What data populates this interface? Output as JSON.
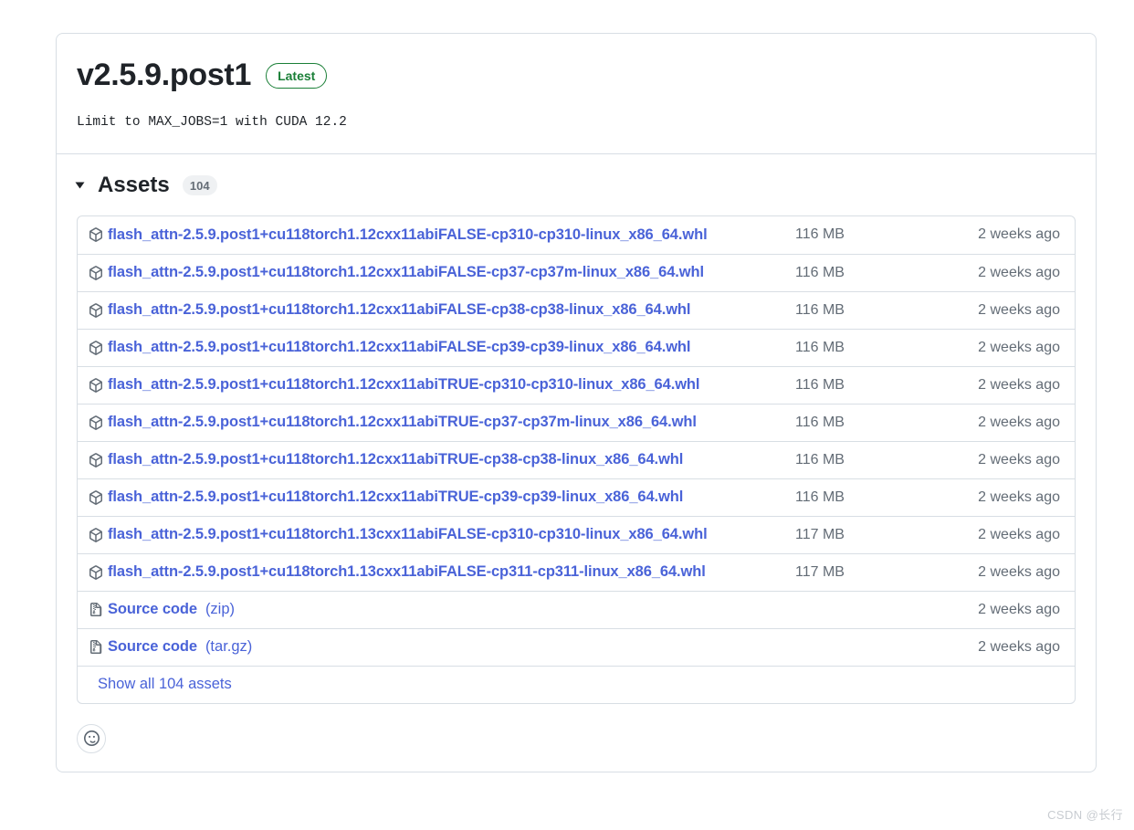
{
  "release": {
    "title": "v2.5.9.post1",
    "badge": "Latest",
    "body": "Limit to MAX_JOBS=1 with CUDA 12.2"
  },
  "assets": {
    "heading": "Assets",
    "count": "104",
    "disclosure_icon": "triangle-down-icon",
    "show_all_label": "Show all 104 assets",
    "rows": [
      {
        "icon": "package-icon",
        "name": "flash_attn-2.5.9.post1+cu118torch1.12cxx11abiFALSE-cp310-cp310-linux_x86_64.whl",
        "format": "",
        "size": "116 MB",
        "date": "2 weeks ago"
      },
      {
        "icon": "package-icon",
        "name": "flash_attn-2.5.9.post1+cu118torch1.12cxx11abiFALSE-cp37-cp37m-linux_x86_64.whl",
        "format": "",
        "size": "116 MB",
        "date": "2 weeks ago"
      },
      {
        "icon": "package-icon",
        "name": "flash_attn-2.5.9.post1+cu118torch1.12cxx11abiFALSE-cp38-cp38-linux_x86_64.whl",
        "format": "",
        "size": "116 MB",
        "date": "2 weeks ago"
      },
      {
        "icon": "package-icon",
        "name": "flash_attn-2.5.9.post1+cu118torch1.12cxx11abiFALSE-cp39-cp39-linux_x86_64.whl",
        "format": "",
        "size": "116 MB",
        "date": "2 weeks ago"
      },
      {
        "icon": "package-icon",
        "name": "flash_attn-2.5.9.post1+cu118torch1.12cxx11abiTRUE-cp310-cp310-linux_x86_64.whl",
        "format": "",
        "size": "116 MB",
        "date": "2 weeks ago"
      },
      {
        "icon": "package-icon",
        "name": "flash_attn-2.5.9.post1+cu118torch1.12cxx11abiTRUE-cp37-cp37m-linux_x86_64.whl",
        "format": "",
        "size": "116 MB",
        "date": "2 weeks ago"
      },
      {
        "icon": "package-icon",
        "name": "flash_attn-2.5.9.post1+cu118torch1.12cxx11abiTRUE-cp38-cp38-linux_x86_64.whl",
        "format": "",
        "size": "116 MB",
        "date": "2 weeks ago"
      },
      {
        "icon": "package-icon",
        "name": "flash_attn-2.5.9.post1+cu118torch1.12cxx11abiTRUE-cp39-cp39-linux_x86_64.whl",
        "format": "",
        "size": "116 MB",
        "date": "2 weeks ago"
      },
      {
        "icon": "package-icon",
        "name": "flash_attn-2.5.9.post1+cu118torch1.13cxx11abiFALSE-cp310-cp310-linux_x86_64.whl",
        "format": "",
        "size": "117 MB",
        "date": "2 weeks ago"
      },
      {
        "icon": "package-icon",
        "name": "flash_attn-2.5.9.post1+cu118torch1.13cxx11abiFALSE-cp311-cp311-linux_x86_64.whl",
        "format": "",
        "size": "117 MB",
        "date": "2 weeks ago"
      },
      {
        "icon": "file-zip-icon",
        "name": "Source code",
        "format": "(zip)",
        "size": "",
        "date": "2 weeks ago"
      },
      {
        "icon": "file-zip-icon",
        "name": "Source code",
        "format": "(tar.gz)",
        "size": "",
        "date": "2 weeks ago"
      }
    ]
  },
  "reactions": {
    "add_reaction_icon": "smiley-icon"
  },
  "watermark": "CSDN @长行",
  "colors": {
    "link": "#4a63d8",
    "badge_green": "#1a7f37",
    "border": "#d8dee4",
    "muted_text": "#636c76"
  }
}
